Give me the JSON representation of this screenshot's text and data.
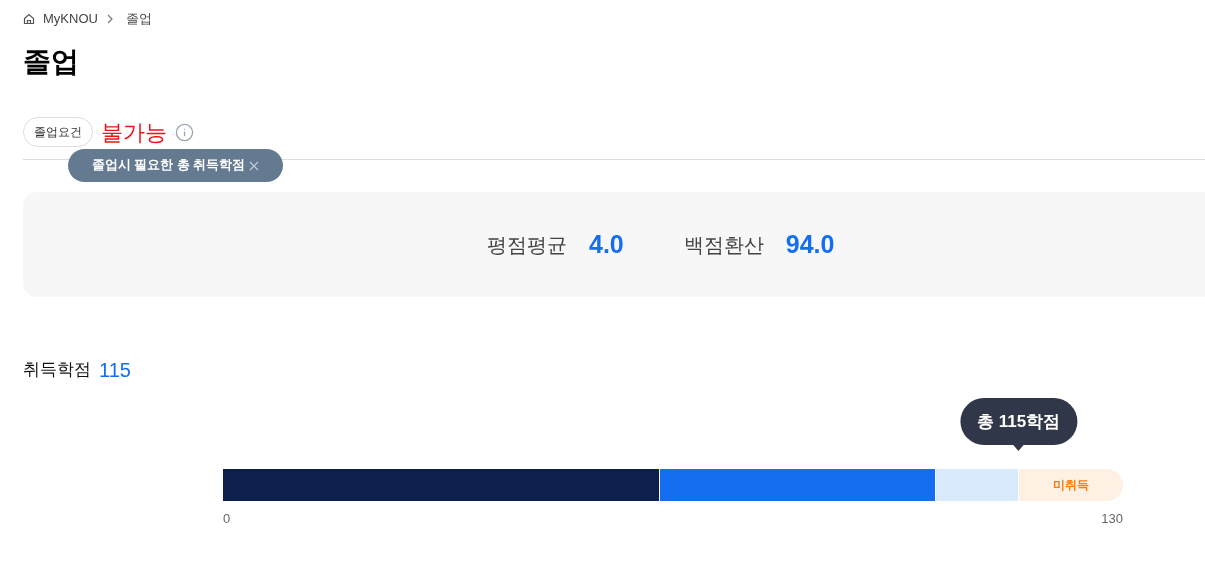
{
  "breadcrumb": {
    "items": [
      "MyKNOU",
      "졸업"
    ]
  },
  "title": "졸업",
  "requirement": {
    "label": "졸업요건",
    "status": "불가능",
    "tooltip": "졸업시 필요한 총 취득학점"
  },
  "grades": [
    {
      "label": "평점평균",
      "value": "4.0"
    },
    {
      "label": "백점환산",
      "value": "94.0"
    }
  ],
  "credits": {
    "label": "취득학점",
    "value": "115",
    "bubble": "총 115학점",
    "segments": [
      {
        "level": 0.485,
        "color": "#0c1f4d"
      },
      {
        "color": "#156ef0"
      },
      {
        "color": "#d9eafd"
      }
    ],
    "remaining_label": "미취득",
    "min": "0",
    "max": "130"
  }
}
